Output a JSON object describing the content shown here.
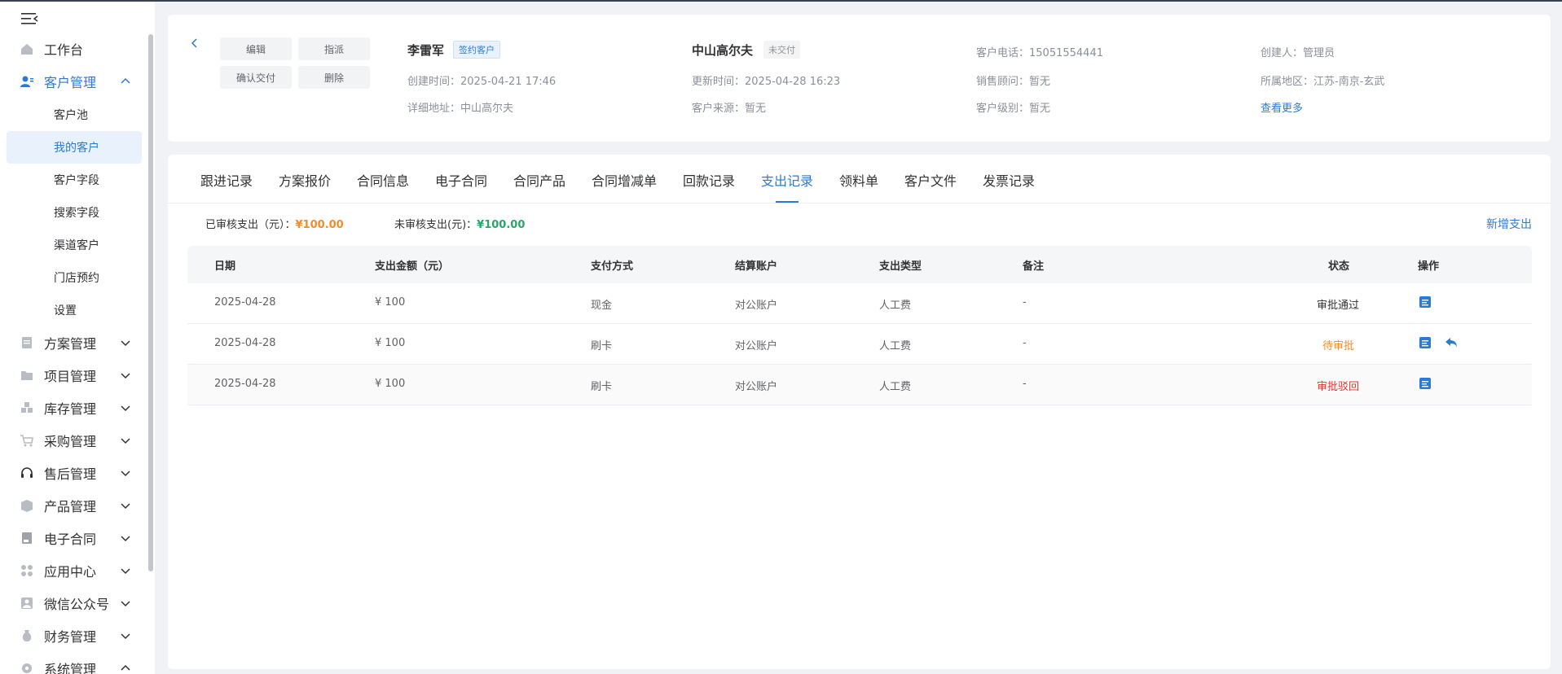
{
  "sidebar": {
    "menu": [
      {
        "label": "工作台",
        "icon": "home-icon"
      },
      {
        "label": "客户管理",
        "icon": "customer-icon",
        "expanded": true
      },
      {
        "label": "方案管理",
        "icon": "document-icon"
      },
      {
        "label": "项目管理",
        "icon": "folder-icon"
      },
      {
        "label": "库存管理",
        "icon": "inventory-icon"
      },
      {
        "label": "采购管理",
        "icon": "cart-icon"
      },
      {
        "label": "售后管理",
        "icon": "headset-icon"
      },
      {
        "label": "产品管理",
        "icon": "box-icon"
      },
      {
        "label": "电子合同",
        "icon": "contract-icon"
      },
      {
        "label": "应用中心",
        "icon": "apps-icon"
      },
      {
        "label": "微信公众号",
        "icon": "wechat-icon"
      },
      {
        "label": "财务管理",
        "icon": "money-bag-icon"
      },
      {
        "label": "系统管理",
        "icon": "settings-icon"
      }
    ],
    "sub_items": [
      {
        "label": "客户池"
      },
      {
        "label": "我的客户",
        "active": true
      },
      {
        "label": "客户字段"
      },
      {
        "label": "搜索字段"
      },
      {
        "label": "渠道客户"
      },
      {
        "label": "门店预约"
      },
      {
        "label": "设置"
      }
    ]
  },
  "header": {
    "buttons": {
      "edit": "编辑",
      "assign": "指派",
      "confirm_delivery": "确认交付",
      "delete": "删除"
    },
    "customer_name": "李雷军",
    "customer_tag": "签约客户",
    "project_name": "中山高尔夫",
    "project_tag": "未交付",
    "info": {
      "created_label": "创建时间：",
      "created": "2025-04-21 17:46",
      "address_label": "详细地址：",
      "address": "中山高尔夫",
      "updated_label": "更新时间：",
      "updated": "2025-04-28 16:23",
      "source_label": "客户来源：",
      "source": "暂无",
      "phone_label": "客户电话：",
      "phone": "15051554441",
      "sales_label": "销售顾问：",
      "sales": "暂无",
      "level_label": "客户级别：",
      "level": "暂无",
      "creator_label": "创建人：",
      "creator": "管理员",
      "region_label": "所属地区：",
      "region": "江苏-南京-玄武"
    },
    "more_link": "查看更多"
  },
  "tabs": [
    "跟进记录",
    "方案报价",
    "合同信息",
    "电子合同",
    "合同产品",
    "合同增减单",
    "回款记录",
    "支出记录",
    "领料单",
    "客户文件",
    "发票记录"
  ],
  "active_tab": "支出记录",
  "summary": {
    "approved_label": "已审核支出（元）：",
    "approved_amount": "¥100.00",
    "pending_label": "未审核支出(元)：",
    "pending_amount": "¥100.00",
    "add_link": "新增支出"
  },
  "table": {
    "columns": [
      "日期",
      "支出金额（元）",
      "支付方式",
      "结算账户",
      "支出类型",
      "备注",
      "状态",
      "操作"
    ],
    "rows": [
      {
        "date": "2025-04-28",
        "amount": "¥ 100",
        "method": "现金",
        "account": "对公账户",
        "type": "人工费",
        "note": "-",
        "status": "审批通过",
        "status_kind": "ok"
      },
      {
        "date": "2025-04-28",
        "amount": "¥ 100",
        "method": "刷卡",
        "account": "对公账户",
        "type": "人工费",
        "note": "-",
        "status": "待审批",
        "status_kind": "wait"
      },
      {
        "date": "2025-04-28",
        "amount": "¥ 100",
        "method": "刷卡",
        "account": "对公账户",
        "type": "人工费",
        "note": "-",
        "status": "审批驳回",
        "status_kind": "reject"
      }
    ]
  },
  "colors": {
    "accent": "#2d7ad6",
    "orange": "#f08c2c",
    "green": "#28a56a",
    "red": "#e5352b"
  }
}
